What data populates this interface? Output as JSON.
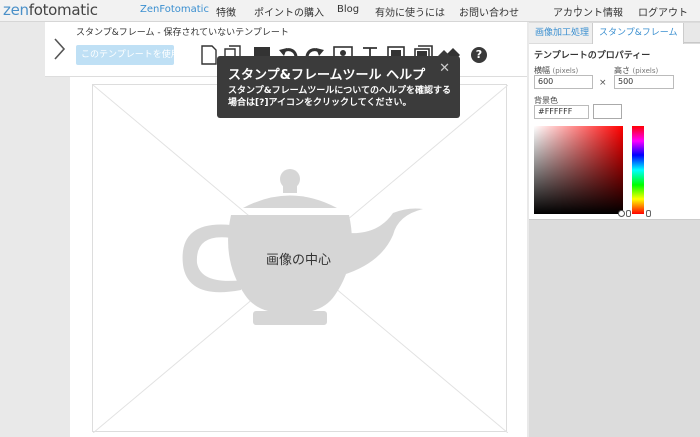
{
  "nav": {
    "logo_a": "zen",
    "logo_b": "fotomatic",
    "items": [
      "ZenFotomatic",
      "特徴",
      "ポイントの購入",
      "Blog",
      "有効に使うには",
      "お問い合わせ"
    ],
    "account": "アカウント情報",
    "logout": "ログアウト"
  },
  "toolbar": {
    "template_title": "スタンプ&フレーム  -  保存されていないテンプレート",
    "use_template_label": "このテンプレートを使用",
    "help_label": "?",
    "tools": [
      "new-page-icon",
      "copy-icon",
      "fill-icon",
      "undo-icon",
      "redo-icon",
      "image-icon",
      "text-icon",
      "frame-icon",
      "layer-icon",
      "eraser-icon"
    ]
  },
  "tooltip": {
    "title": "スタンプ&フレームツール ヘルプ",
    "body": "スタンプ&フレームツールについてのヘルプを確認する場合は[?]アイコンをクリックしてください。",
    "close": "✕"
  },
  "canvas": {
    "center_label": "画像の中心"
  },
  "panel": {
    "tab_image": "画像加工処理",
    "tab_stamp": "スタンプ&フレーム",
    "props_title": "テンプレートのプロパティー",
    "width_label": "横幅",
    "width_unit": "(pixels)",
    "width_value": "600",
    "height_label": "高さ",
    "height_unit": "(pixels)",
    "height_value": "500",
    "times": "×",
    "bg_label": "背景色",
    "bg_value": "#FFFFFF"
  },
  "colors": {
    "accent": "#3a8fd0",
    "tooltip_bg": "#3b3b3b",
    "teapot": "#d6d6d6",
    "background_color": "#FFFFFF"
  }
}
